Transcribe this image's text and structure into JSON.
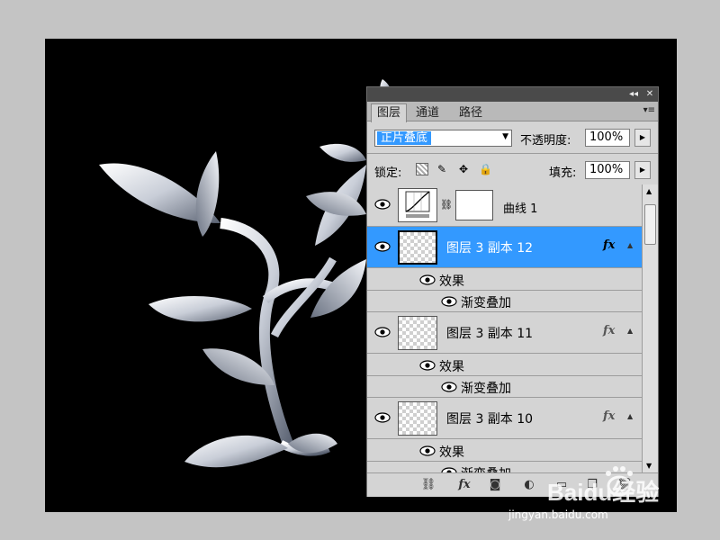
{
  "panel": {
    "tabs": [
      {
        "label": "图层",
        "active": true
      },
      {
        "label": "通道",
        "active": false
      },
      {
        "label": "路径",
        "active": false
      }
    ],
    "titlebar_icons": [
      "collapse-icon",
      "close-icon"
    ],
    "blend_mode": "正片叠底",
    "opacity_label": "不透明度:",
    "opacity_value": "100%",
    "lock_label": "锁定:",
    "fill_label": "填充:",
    "fill_value": "100%",
    "layers": [
      {
        "name": "曲线 1",
        "type": "adjustment"
      },
      {
        "name": "图层 3 副本 12",
        "selected": true,
        "fx": "fx",
        "effects_label": "效果",
        "effect": "渐变叠加"
      },
      {
        "name": "图层 3 副本 11",
        "fx": "fx",
        "effects_label": "效果",
        "effect": "渐变叠加"
      },
      {
        "name": "图层 3 副本 10",
        "fx": "fx",
        "effects_label": "效果",
        "effect": "渐变叠加"
      }
    ],
    "footer_icons": [
      "link-icon",
      "fx-icon",
      "mask-icon",
      "adjustment-icon",
      "folder-icon",
      "new-layer-icon",
      "trash-icon"
    ]
  },
  "watermark": {
    "logo": "Baidu经验",
    "url": "jingyan.baidu.com"
  },
  "colors": {
    "selection": "#3399ff",
    "panel_bg": "#d4d4d4",
    "canvas_bg": "#000000"
  }
}
